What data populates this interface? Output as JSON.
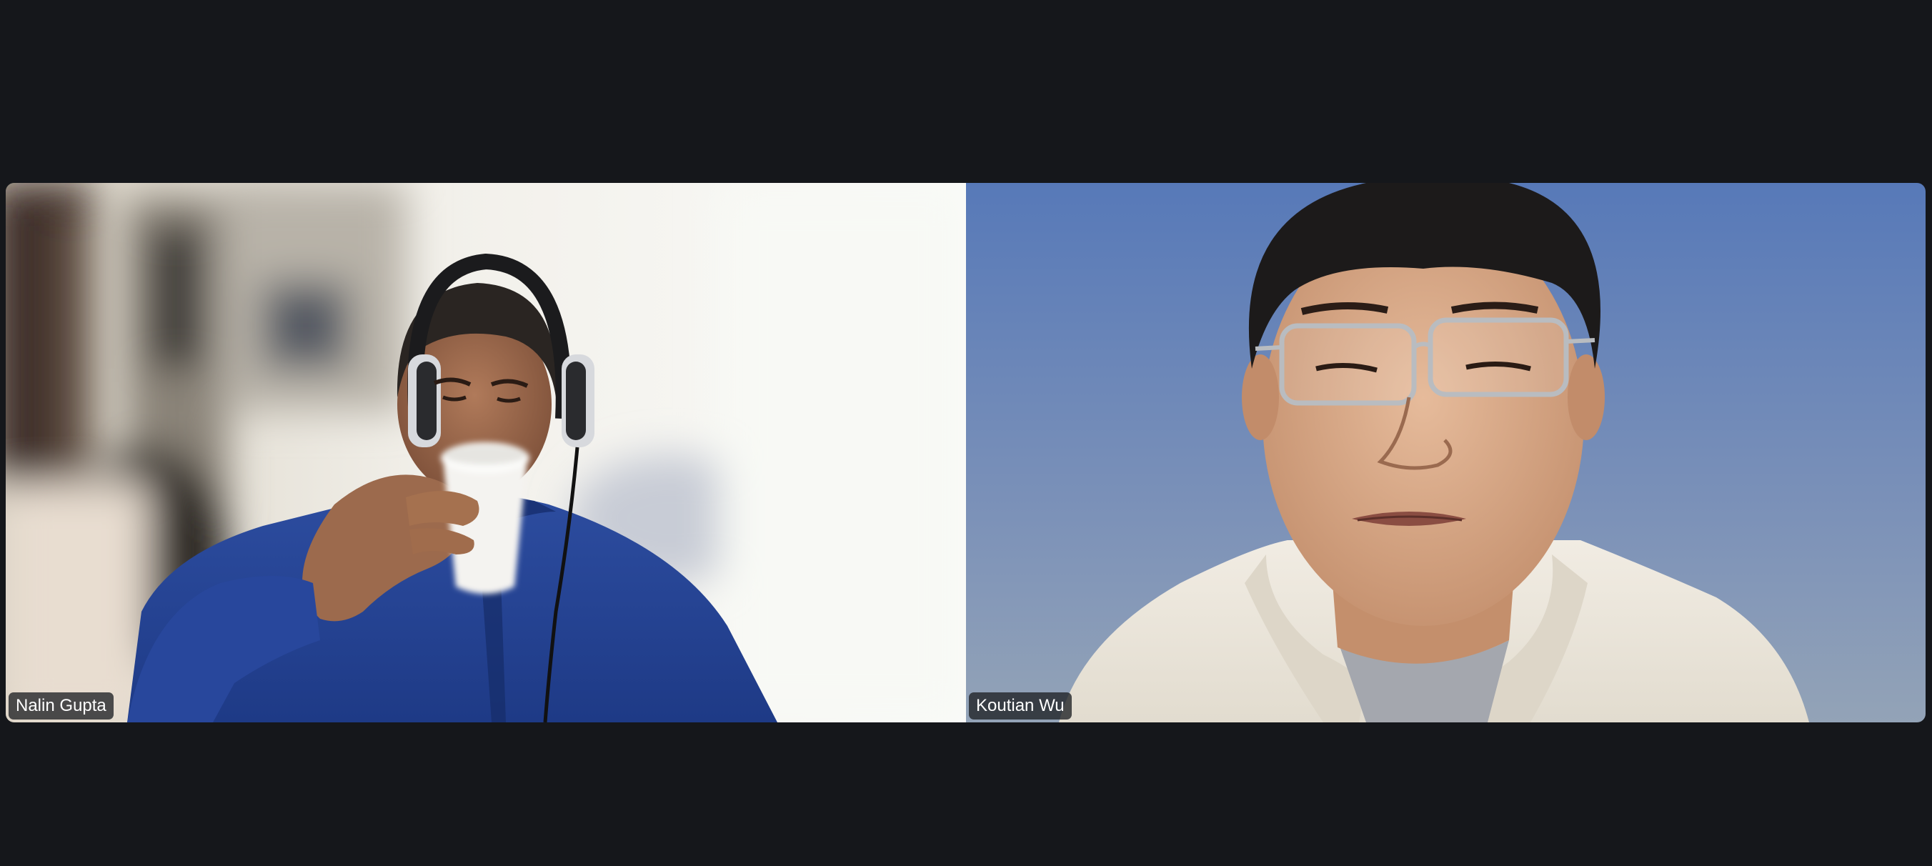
{
  "meeting": {
    "participants": [
      {
        "name": "Nalin Gupta"
      },
      {
        "name": "Koutian Wu"
      }
    ]
  },
  "colors": {
    "window_background": "#15171b",
    "name_tag_background": "#1e2024",
    "name_tag_text": "#ffffff",
    "right_backdrop_top": "#5779b8",
    "right_backdrop_bottom": "#93a3b7"
  }
}
